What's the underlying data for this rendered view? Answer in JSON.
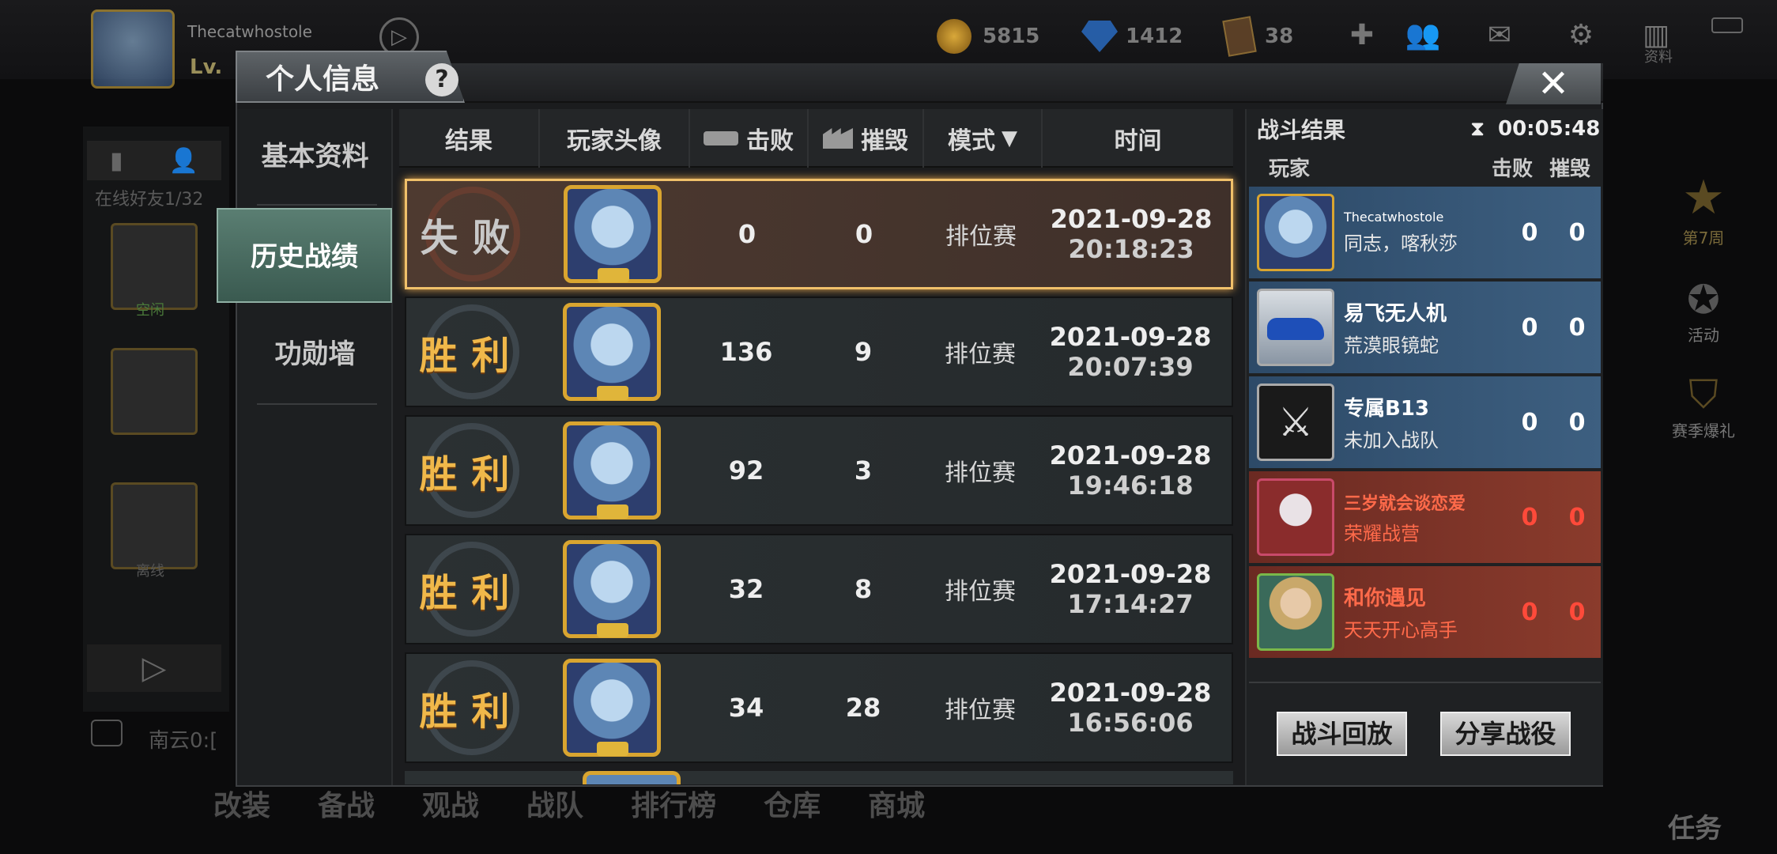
{
  "header": {
    "username": "Thecatwhostole",
    "level_label": "Lv.",
    "gold": "5815",
    "diamonds": "1412",
    "cards": "38",
    "ziliao_label": "资料"
  },
  "left_bg": {
    "online_friends": "在线好友1/32",
    "chat_text": "南云0:[",
    "friend1_name": "空闲",
    "friend2_name": "离线"
  },
  "right_bg": {
    "week": "第7周",
    "activity": "活动",
    "season_gift": "赛季爆礼",
    "task": "任务"
  },
  "bottom_nav": [
    "改装",
    "备战",
    "观战",
    "战队",
    "排行榜",
    "仓库",
    "商城"
  ],
  "dialog": {
    "title": "个人信息",
    "help": "?",
    "close": "✕",
    "nav": {
      "basic": "基本资料",
      "history": "历史战绩",
      "honor": "功勋墙"
    },
    "table_headers": {
      "result": "结果",
      "avatar": "玩家头像",
      "defeat": "击败",
      "destroy": "摧毁",
      "mode": "模式",
      "time": "时间"
    },
    "rows": [
      {
        "result": "失败",
        "defeat": "0",
        "destroy": "0",
        "mode": "排位赛",
        "date": "2021-09-28",
        "time": "20:18:23"
      },
      {
        "result": "胜利",
        "defeat": "136",
        "destroy": "9",
        "mode": "排位赛",
        "date": "2021-09-28",
        "time": "20:07:39"
      },
      {
        "result": "胜利",
        "defeat": "92",
        "destroy": "3",
        "mode": "排位赛",
        "date": "2021-09-28",
        "time": "19:46:18"
      },
      {
        "result": "胜利",
        "defeat": "32",
        "destroy": "8",
        "mode": "排位赛",
        "date": "2021-09-28",
        "time": "17:14:27"
      },
      {
        "result": "胜利",
        "defeat": "34",
        "destroy": "28",
        "mode": "排位赛",
        "date": "2021-09-28",
        "time": "16:56:06"
      }
    ],
    "battle": {
      "title": "战斗结果",
      "timer": "00:05:48",
      "col_player": "玩家",
      "col_defeat": "击败",
      "col_destroy": "摧毁",
      "players": [
        {
          "name": "Thecatwhostole",
          "sub": "同志，喀秋莎",
          "defeat": "0",
          "destroy": "0",
          "team": "blue"
        },
        {
          "name": "易飞无人机",
          "sub": "荒漠眼镜蛇",
          "defeat": "0",
          "destroy": "0",
          "team": "blue"
        },
        {
          "name": "专属B13",
          "sub": "未加入战队",
          "defeat": "0",
          "destroy": "0",
          "team": "blue"
        },
        {
          "name": "三岁就会谈恋爱",
          "sub": "荣耀战营",
          "defeat": "0",
          "destroy": "0",
          "team": "red"
        },
        {
          "name": "和你遇见",
          "sub": "天天开心高手",
          "defeat": "0",
          "destroy": "0",
          "team": "red"
        }
      ],
      "replay_button": "战斗回放",
      "share_button": "分享战役"
    }
  },
  "colors": {
    "gold_text": "#f0b84a",
    "active_tab": "#5a7e72",
    "red_team": "#ff4a3a",
    "blue_team": "#3d5f80"
  }
}
